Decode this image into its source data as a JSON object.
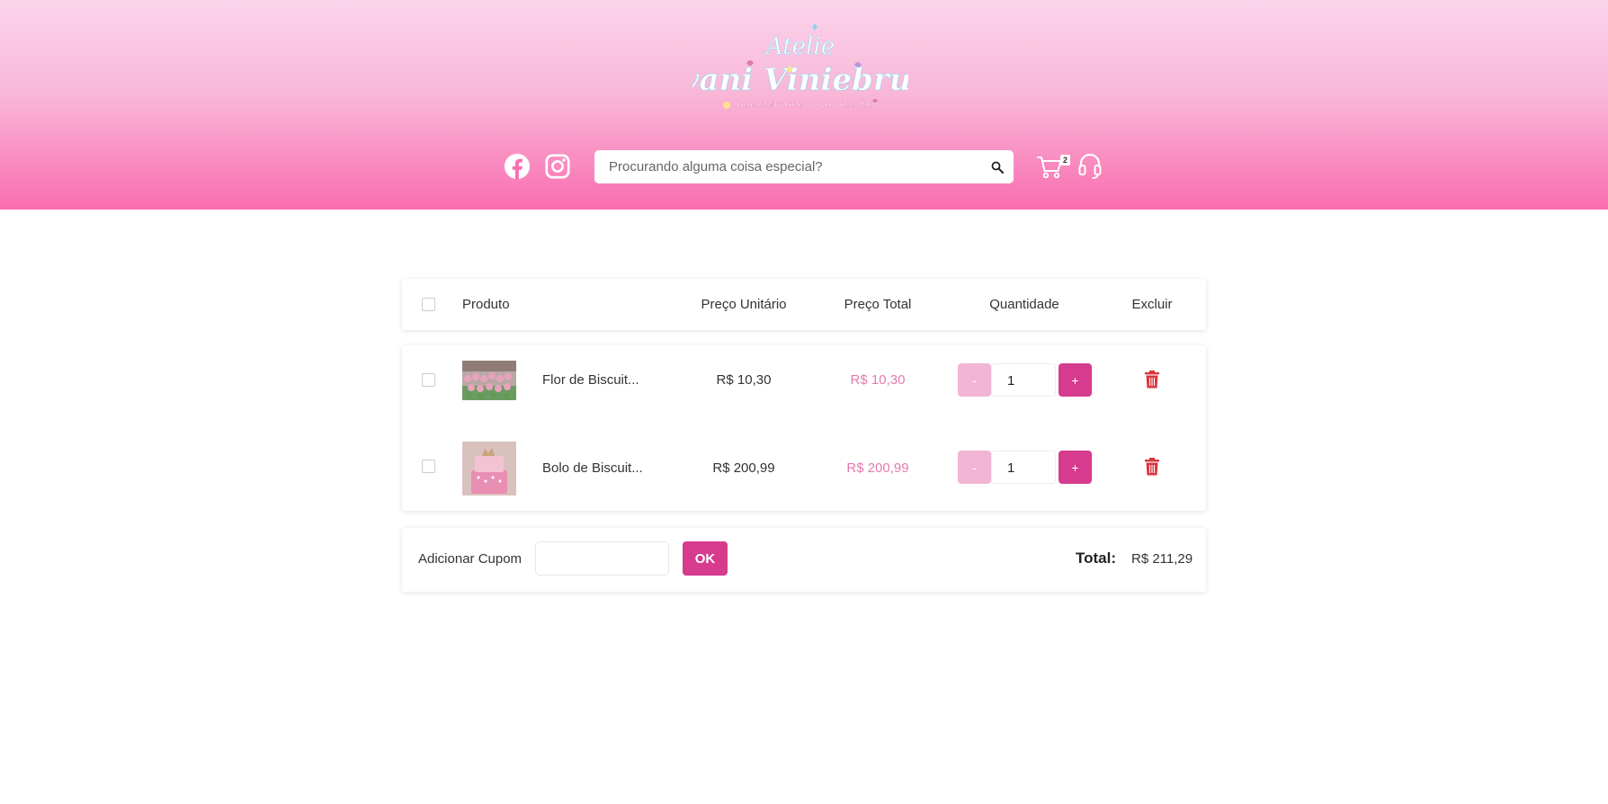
{
  "brand": {
    "logo_line1": "Atelie",
    "logo_line2": "Ivani Viniebrun",
    "logo_tagline": "Biscuit Amor em cada detalhe"
  },
  "header": {
    "search_placeholder": "Procurando alguma coisa especial?",
    "cart_count": "2",
    "gradient_top": "#fad4ea",
    "gradient_bottom": "#f96db0"
  },
  "table": {
    "columns": {
      "product": "Produto",
      "unit_price": "Preço Unitário",
      "total_price": "Preço Total",
      "quantity": "Quantidade",
      "delete": "Excluir"
    },
    "rows": [
      {
        "name": "Flor de Biscuit...",
        "unit_price": "R$ 10,30",
        "total_price": "R$ 10,30",
        "quantity": "1",
        "minus": "-",
        "plus": "+"
      },
      {
        "name": "Bolo de Biscuit...",
        "unit_price": "R$ 200,99",
        "total_price": "R$ 200,99",
        "quantity": "1",
        "minus": "-",
        "plus": "+"
      }
    ]
  },
  "footer": {
    "coupon_label": "Adicionar Cupom",
    "coupon_value": "",
    "ok_label": "OK",
    "total_label": "Total:",
    "total_value": "R$ 211,29"
  },
  "colors": {
    "accent": "#d63b8e",
    "accent_light": "#f2b5d4",
    "price_pink": "#e57ab0",
    "trash_red": "#d9363e"
  }
}
